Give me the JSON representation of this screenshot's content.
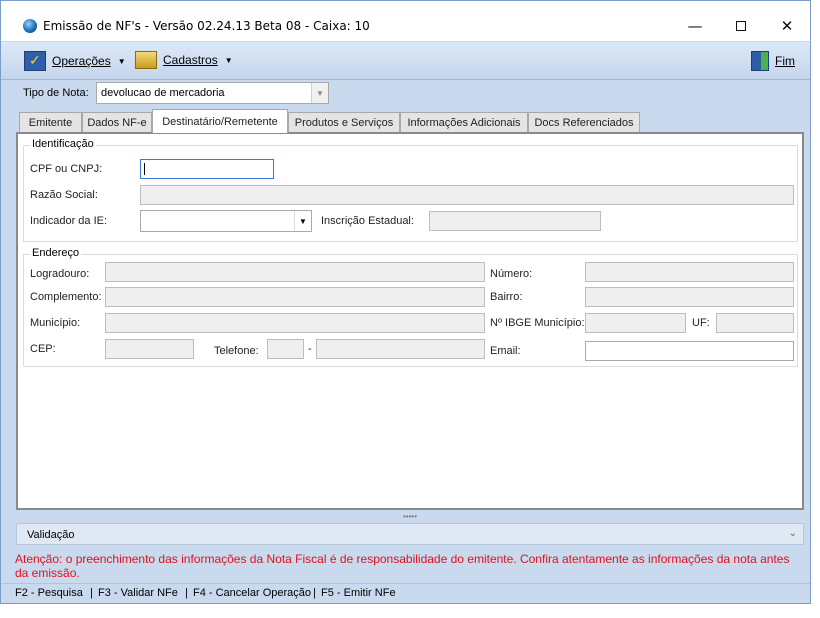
{
  "window": {
    "title": "Emissão de NF's - Versão 02.24.13 Beta 08 - Caixa: 10",
    "min_symbol": "—",
    "close_symbol": "✕"
  },
  "menu": {
    "operacoes": {
      "label": "Operações",
      "icon": "checklist-icon"
    },
    "cadastros": {
      "label": "Cadastros",
      "icon": "cards-icon"
    },
    "fim": {
      "label": "Fim",
      "icon": "exit-door-icon"
    },
    "caret": "▼"
  },
  "tipo_nota": {
    "label": "Tipo de Nota:",
    "value": "devolucao de mercadoria"
  },
  "tabs": [
    {
      "label": "Emitente",
      "active": false
    },
    {
      "label": "Dados NF-e",
      "active": false
    },
    {
      "label": "Destinatário/Remetente",
      "active": true
    },
    {
      "label": "Produtos e Serviços",
      "active": false
    },
    {
      "label": "Informações Adicionais",
      "active": false
    },
    {
      "label": "Docs Referenciados",
      "active": false
    }
  ],
  "identificacao": {
    "title": "Identificação",
    "cpf_label": "CPF ou CNPJ:",
    "cpf_value": "",
    "razao_label": "Razão Social:",
    "razao_value": "",
    "ie_label": "Indicador da IE:",
    "ie_value": "",
    "inscricao_label": "Inscrição Estadual:",
    "inscricao_value": ""
  },
  "endereco": {
    "title": "Endereço",
    "logradouro_label": "Logradouro:",
    "numero_label": "Número:",
    "complemento_label": "Complemento:",
    "bairro_label": "Bairro:",
    "municipio_label": "Município:",
    "ibge_label": "Nº IBGE Município:",
    "uf_label": "UF:",
    "cep_label": "CEP:",
    "telefone_label": "Telefone:",
    "telefone_sep": "-",
    "email_label": "Email:"
  },
  "validacao": {
    "label": "Validação",
    "grip": "•••••",
    "chevron": "⌄"
  },
  "warning": "Atenção: o preenchimento das informações da Nota Fiscal é de responsabilidade do emitente. Confira atentamente as informações da nota antes da emissão.",
  "colors": {
    "warning": "#e0121c",
    "chrome": "#c9d9ee",
    "focus_border": "#3b7bd6"
  },
  "shortcuts": [
    "F2 - Pesquisa",
    "|",
    "F3 - Validar NFe",
    "|",
    "F4 - Cancelar Operação",
    "|",
    "F5 - Emitir NFe"
  ]
}
